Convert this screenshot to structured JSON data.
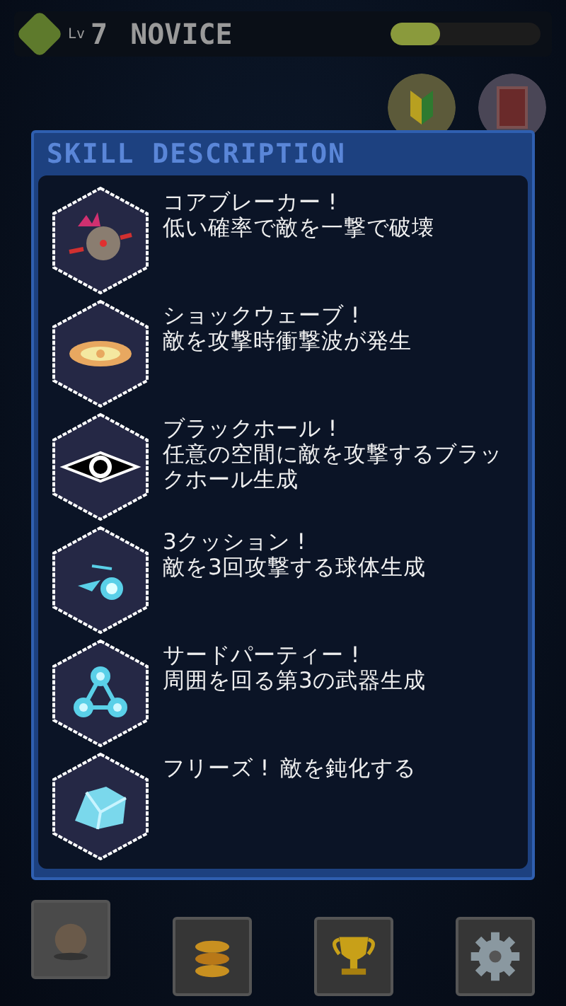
{
  "status": {
    "level_label": "Lv",
    "level": "7",
    "rank": "NOVICE",
    "xp": {
      "level": 0.33
    }
  },
  "dialog": {
    "title": "SKILL DESCRIPTION",
    "skills": [
      {
        "kind": "stacked",
        "name": "コアブレーカー !",
        "description": "低い確率で敵を一撃で破壊"
      },
      {
        "kind": "stacked",
        "name": "ショックウェーブ !",
        "description": "敵を攻撃時衝撃波が発生"
      },
      {
        "kind": "stacked",
        "name": "ブラックホール !",
        "description": "任意の空間に敵を攻撃するブラックホール生成"
      },
      {
        "kind": "stacked",
        "name": "3クッション !",
        "description": "敵を3回攻撃する球体生成"
      },
      {
        "kind": "stacked",
        "name": "サードパーティー !",
        "description": "周囲を回る第3の武器生成"
      },
      {
        "kind": "inline",
        "name": "フリーズ !",
        "description": "敵を鈍化する"
      }
    ]
  },
  "bottom_nav": [
    {
      "selected": true
    },
    {
      "selected": false
    },
    {
      "selected": false
    },
    {
      "selected": false
    }
  ]
}
